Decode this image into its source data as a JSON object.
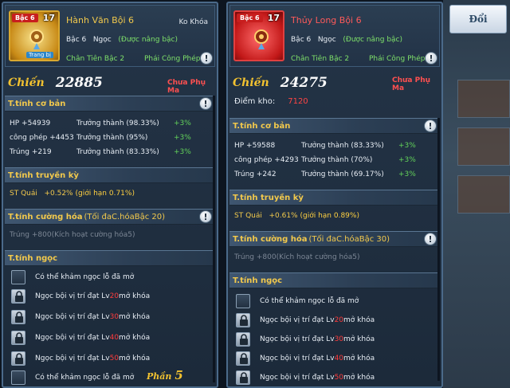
{
  "swap_button": "Đổi",
  "left": {
    "rank_badge": "Bậc 6",
    "rank_num": "17",
    "item_tag": "Trang bị",
    "name": "Hành Văn Bội 6",
    "lock_state": "Ko Khóa",
    "level": "Bậc 6",
    "gem": "Ngọc",
    "upgrade_note": "(Được nâng bậc)",
    "tier": "Chân Tiên Bậc 2",
    "school": "Phái Công Phép",
    "power_label": "Chiến",
    "power_value": "22885",
    "enchant": "Chưa Phụ Ma",
    "basic_title": "T.tính cơ bản",
    "stats": [
      {
        "name": "HP +54939",
        "growth": "Trưởng thành (98.33%)",
        "bonus": "+3%"
      },
      {
        "name": "công phép +4453",
        "growth": "Trưởng thành (95%)",
        "bonus": "+3%"
      },
      {
        "name": "Trúng +219",
        "growth": "Trưởng thành (83.33%)",
        "bonus": "+3%"
      }
    ],
    "legend_title": "T.tính truyền kỳ",
    "legend_stat": "ST Quái",
    "legend_value": "+0.52%",
    "legend_limit": "(giới hạn 0.71%)",
    "enhance_title": "T.tính cường hóa",
    "enhance_sub": "(Tối đaC.hóaBậc 20)",
    "enhance_line": "Trúng +800(Kích hoạt cường hóa5)",
    "gem_title": "T.tính ngọc",
    "gem_open_text": "Có thể khảm ngọc lỗ đã mở",
    "gem_slots": [
      {
        "pre": "Ngọc bội vị trí đạt Lv",
        "lv": "20",
        "post": " mở khóa"
      },
      {
        "pre": "Ngọc bội vị trí đạt Lv",
        "lv": "30",
        "post": " mở khóa"
      },
      {
        "pre": "Ngọc bội vị trí đạt Lv",
        "lv": "40",
        "post": " mở khóa"
      },
      {
        "pre": "Ngọc bội vị trí đạt Lv",
        "lv": "50",
        "post": " mở khóa"
      }
    ],
    "gem_open_text2": "Có thể khảm ngọc lỗ đã mở",
    "page_label": "Phần",
    "page_num": "5"
  },
  "right": {
    "rank_badge": "Bậc 6",
    "rank_num": "17",
    "name": "Thủy Long Bội 6",
    "level": "Bậc 6",
    "gem": "Ngọc",
    "upgrade_note": "(Được nâng bậc)",
    "tier": "Chân Tiên Bậc 2",
    "school": "Phái Công Phép",
    "power_label": "Chiến",
    "power_value": "24275",
    "enchant": "Chưa Phụ Ma",
    "storage_label": "Điểm kho:",
    "storage_value": "7120",
    "basic_title": "T.tính cơ bản",
    "stats": [
      {
        "name": "HP +59588",
        "growth": "Trưởng thành (83.33%)",
        "bonus": "+3%"
      },
      {
        "name": "công phép +4293",
        "growth": "Trưởng thành (70%)",
        "bonus": "+3%"
      },
      {
        "name": "Trúng +242",
        "growth": "Trưởng thành (69.17%)",
        "bonus": "+3%"
      }
    ],
    "legend_title": "T.tính truyền kỳ",
    "legend_stat": "ST Quái",
    "legend_value": "+0.61%",
    "legend_limit": "(giới hạn 0.89%)",
    "enhance_title": "T.tính cường hóa",
    "enhance_sub": "(Tối đaC.hóaBậc 30)",
    "enhance_line": "Trúng +800(Kích hoạt cường hóa5)",
    "gem_title": "T.tính ngọc",
    "gem_open_text": "Có thể khảm ngọc lỗ đã mở",
    "gem_slots": [
      {
        "pre": "Ngọc bội vị trí đạt Lv",
        "lv": "20",
        "post": " mở khóa"
      },
      {
        "pre": "Ngọc bội vị trí đạt Lv",
        "lv": "30",
        "post": " mở khóa"
      },
      {
        "pre": "Ngọc bội vị trí đạt Lv",
        "lv": "40",
        "post": " mở khóa"
      },
      {
        "pre": "Ngọc bội vị trí đạt Lv",
        "lv": "50",
        "post": " mở khóa"
      }
    ]
  }
}
